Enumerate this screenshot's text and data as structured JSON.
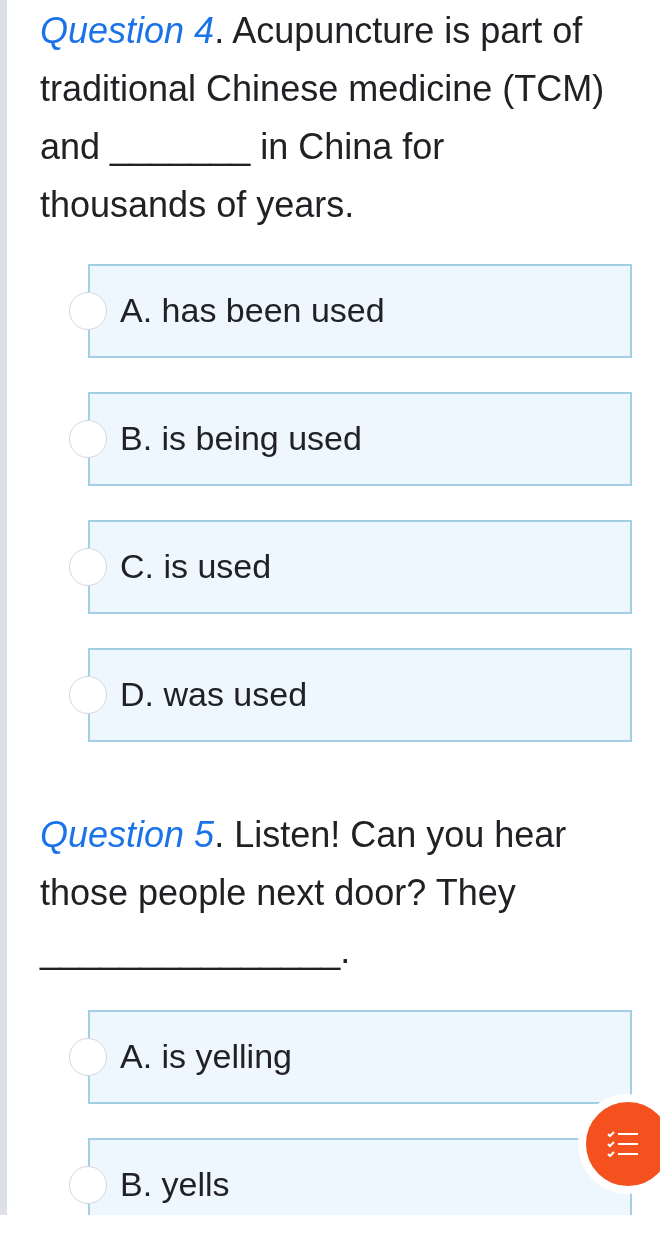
{
  "questions": [
    {
      "label": "Question 4",
      "text": ". Acupuncture is part of traditional Chinese medicine (TCM) and _______ in China for thousands of years.",
      "options": [
        {
          "text": "A. has been used",
          "selected": false
        },
        {
          "text": "B. is being used",
          "selected": false
        },
        {
          "text": "C. is used",
          "selected": false
        },
        {
          "text": "D. was used",
          "selected": false
        }
      ]
    },
    {
      "label": "Question 5",
      "text": ". Listen! Can you hear those people next door? They _______________.",
      "options": [
        {
          "text": "A. is yelling",
          "selected": false
        },
        {
          "text": "B. yells",
          "selected": false
        }
      ]
    }
  ]
}
